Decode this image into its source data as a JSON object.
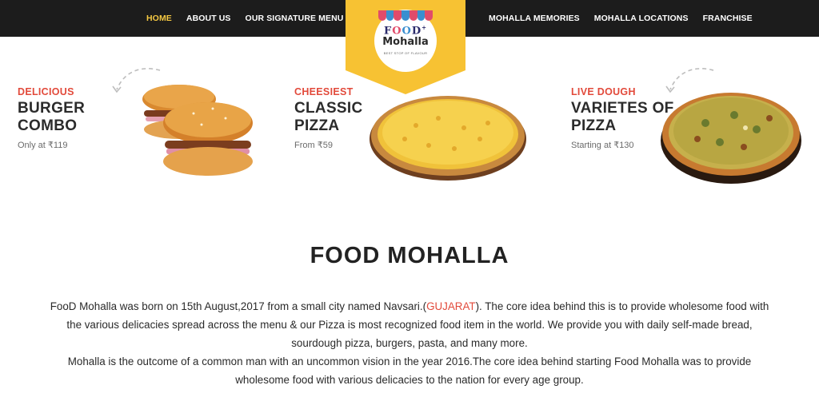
{
  "nav": {
    "left": [
      "HOME",
      "ABOUT US",
      "OUR SIGNATURE MENU"
    ],
    "right": [
      "MOHALLA MEMORIES",
      "MOHALLA LOCATIONS",
      "FRANCHISE"
    ],
    "active_index": 0
  },
  "logo": {
    "line1_parts": [
      "F",
      "O",
      "O",
      "D"
    ],
    "line1_sup": "+",
    "line2": "Mohalla",
    "tagline": "BEST STOP OF FLAVOUR"
  },
  "promos": [
    {
      "eyebrow": "DELICIOUS",
      "title_line1": "BURGER",
      "title_line2": "COMBO",
      "price": "Only at ₹119"
    },
    {
      "eyebrow": "CHEESIEST",
      "title_line1": "CLASSIC",
      "title_line2": "PIZZA",
      "price": "From ₹59"
    },
    {
      "eyebrow": "LIVE DOUGH",
      "title_line1": "VARIETES OF",
      "title_line2": "PIZZA",
      "price": "Starting at ₹130"
    }
  ],
  "about": {
    "title": "FOOD MOHALLA",
    "p1_before": "FooD Mohalla was born on 15th August,2017 from a small city named Navsari.(",
    "p1_highlight": "GUJARAT",
    "p1_after": "). The core idea behind this is to provide wholesome food with",
    "p1_line2": "the various delicacies spread across the menu & our Pizza is most recognized food item in the world. We provide you with daily self-made bread,",
    "p1_line3": "sourdough pizza, burgers, pasta, and many more.",
    "p2_line1": "Mohalla is the outcome of a common man with an uncommon vision in the year 2016.The core idea behind starting Food Mohalla was to provide",
    "p2_line2": "wholesome food with various delicacies to the nation for every age group."
  },
  "colors": {
    "nav_bg": "#1c1c1c",
    "nav_active": "#f5c842",
    "badge_yellow": "#f7c233",
    "accent_red": "#e24a3b"
  }
}
